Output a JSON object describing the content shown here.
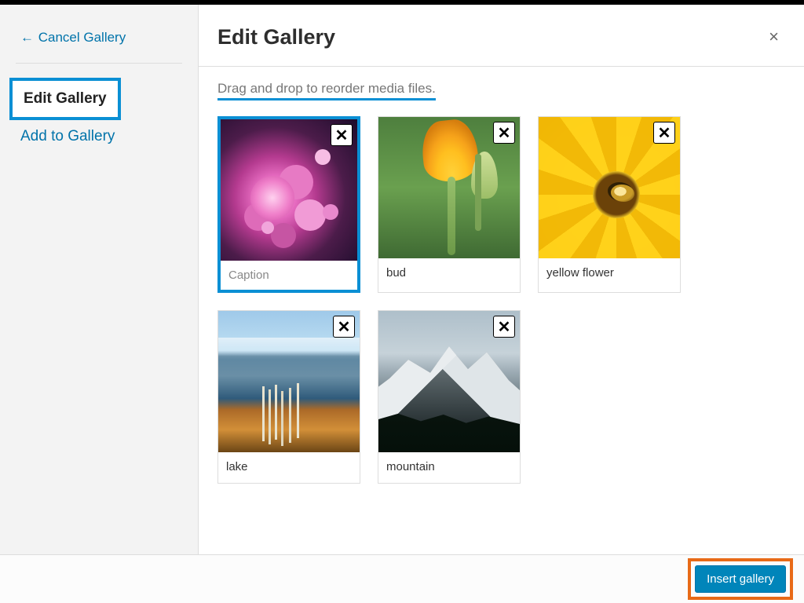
{
  "sidebar": {
    "cancel_label": "Cancel Gallery",
    "items": [
      {
        "label": "Edit Gallery",
        "active": true
      },
      {
        "label": "Add to Gallery",
        "active": false
      }
    ]
  },
  "header": {
    "title": "Edit Gallery",
    "close_glyph": "×"
  },
  "instruction": "Drag and drop to reorder media files.",
  "gallery": {
    "caption_placeholder": "Caption",
    "items": [
      {
        "caption": "",
        "selected": true,
        "image": "pinkflowers"
      },
      {
        "caption": "bud",
        "selected": false,
        "image": "bud"
      },
      {
        "caption": "yellow flower",
        "selected": false,
        "image": "yellowflower"
      },
      {
        "caption": "lake",
        "selected": false,
        "image": "lake"
      },
      {
        "caption": "mountain",
        "selected": false,
        "image": "mountain"
      }
    ],
    "remove_glyph": "✕"
  },
  "footer": {
    "insert_label": "Insert gallery"
  },
  "annotations": {
    "highlight_color_blue": "#0a8fd4",
    "highlight_color_orange": "#e86a17"
  }
}
